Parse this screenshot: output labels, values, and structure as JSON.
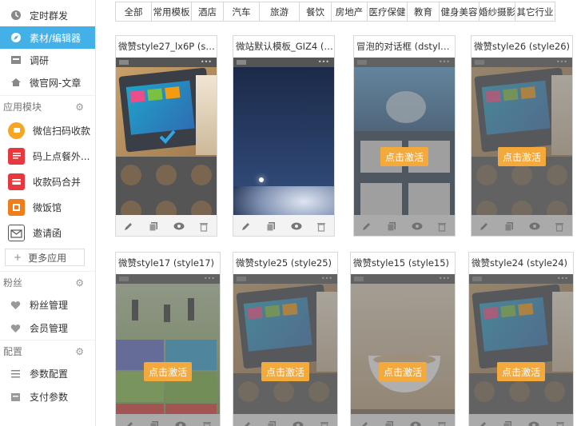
{
  "sidebar": {
    "top_items": [
      {
        "label": "定时群发",
        "icon": "clock-icon"
      },
      {
        "label": "素材/编辑器",
        "icon": "compass-icon",
        "active": true
      },
      {
        "label": "调研",
        "icon": "survey-icon"
      },
      {
        "label": "微官网-文章",
        "icon": "home-icon"
      }
    ],
    "app_section": "应用模块",
    "apps": [
      {
        "label": "微信扫码收款",
        "icon": "wallet-icon",
        "color": "#f5a623"
      },
      {
        "label": "码上点餐外...",
        "icon": "menu-order-icon",
        "color": "#e8383d"
      },
      {
        "label": "收款码合并",
        "icon": "card-icon",
        "color": "#e8383d"
      },
      {
        "label": "微饭馆",
        "icon": "restaurant-icon",
        "color": "#f07c1a"
      },
      {
        "label": "邀请函",
        "icon": "invitation-icon",
        "color": "#555555"
      }
    ],
    "more_apps": "更多应用",
    "fans_section": "粉丝",
    "fans_items": [
      {
        "label": "粉丝管理",
        "icon": "heart-icon"
      },
      {
        "label": "会员管理",
        "icon": "heart-icon"
      }
    ],
    "config_section": "配置",
    "config_items": [
      {
        "label": "参数配置",
        "icon": "list-icon"
      },
      {
        "label": "支付参数",
        "icon": "payment-icon"
      }
    ]
  },
  "tabs": [
    "全部",
    "常用模板",
    "酒店",
    "汽车",
    "旅游",
    "餐饮",
    "房地产",
    "医疗保健",
    "教育",
    "健身美容",
    "婚纱摄影",
    "其它行业"
  ],
  "activate_label": "点击激活",
  "cards_row1": [
    {
      "title": "微赞style27_lx6P (styl...",
      "thumb": "metro",
      "active": true
    },
    {
      "title": "微站默认模板_GIZ4 (d...",
      "thumb": "night",
      "active": true
    },
    {
      "title": "冒泡的对话框 (dstyle06)",
      "thumb": "bubble",
      "active": false
    },
    {
      "title": "微赞style26 (style26)",
      "thumb": "metro",
      "active": false
    }
  ],
  "cards_row2": [
    {
      "title": "微赞style17 (style17)",
      "thumb": "sports",
      "active": false
    },
    {
      "title": "微赞style25 (style25)",
      "thumb": "metro",
      "active": false
    },
    {
      "title": "微赞style15 (style15)",
      "thumb": "coffee",
      "active": false
    },
    {
      "title": "微赞style24 (style24)",
      "thumb": "metro",
      "active": false
    }
  ],
  "colors": {
    "accent": "#44b0e8",
    "activate": "#f4a93c"
  }
}
